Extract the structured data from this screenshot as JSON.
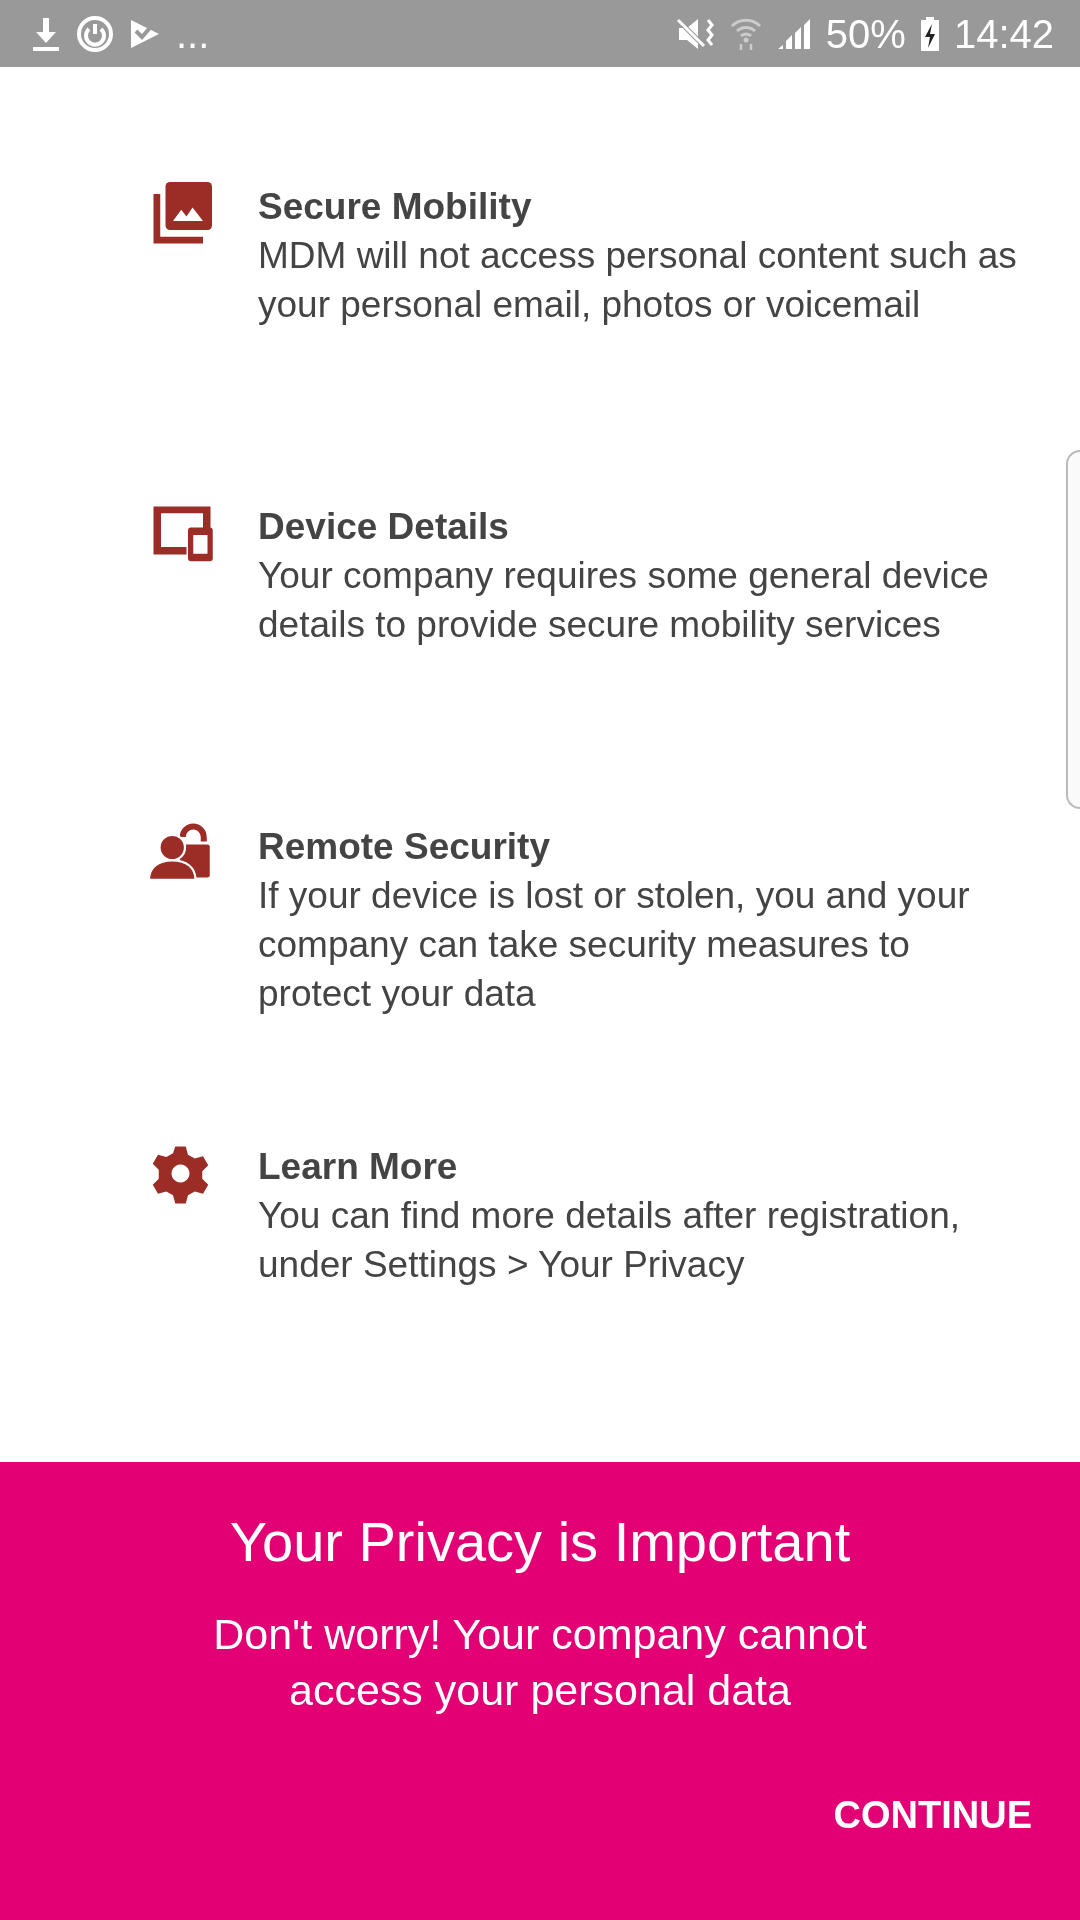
{
  "status_bar": {
    "more": "...",
    "battery": "50%",
    "time": "14:42"
  },
  "items": [
    {
      "kind": "photos",
      "title": "Secure Mobility",
      "text": "MDM will not access personal content such as your personal email, photos or voicemail"
    },
    {
      "kind": "devices",
      "title": "Device Details",
      "text": "Your company requires some general device details to provide secure mobility services"
    },
    {
      "kind": "person-lock",
      "title": "Remote Security",
      "text": "If your device is lost or stolen, you and your company can take security measures to protect your data"
    },
    {
      "kind": "gear",
      "title": "Learn More",
      "text": "You can find more details after registration, under Settings > Your Privacy"
    }
  ],
  "banner": {
    "title": "Your Privacy is Important",
    "text": "Don't worry! Your company cannot access your personal data",
    "button": "CONTINUE"
  }
}
